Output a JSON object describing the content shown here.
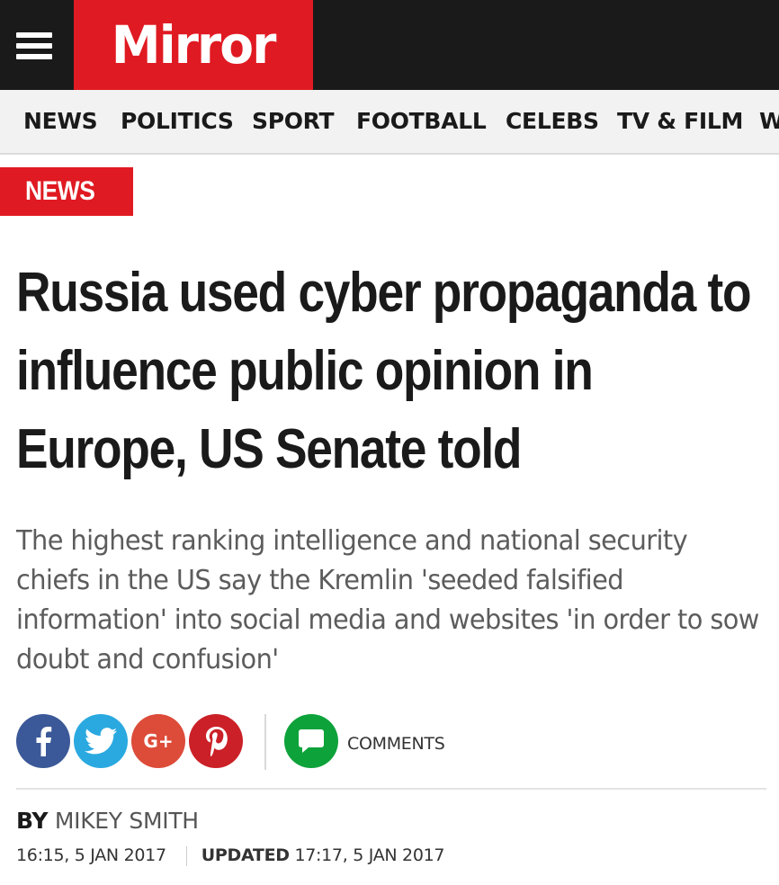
{
  "header": {
    "logo_text": "Mirror",
    "brand_color": "#e01a22",
    "menu_icon": "hamburger-menu-icon"
  },
  "nav": {
    "items": [
      "NEWS",
      "POLITICS",
      "SPORT",
      "FOOTBALL",
      "CELEBS",
      "TV & FILM",
      "W"
    ]
  },
  "article": {
    "section": "NEWS",
    "headline": "Russia used cyber propaganda to influence public opinion in Europe, US Senate told",
    "standfirst": "The highest ranking intelligence and national security chiefs in the US say the Kremlin 'seeded falsified information' into social media and websites 'in order to sow doubt and confusion'",
    "share": {
      "facebook_icon": "facebook-icon",
      "twitter_icon": "twitter-icon",
      "googleplus_label": "G+",
      "pinterest_icon": "pinterest-icon",
      "comments_icon": "comment-bubble-icon",
      "comments_label": "COMMENTS"
    },
    "byline": {
      "by_label": "BY",
      "author": "MIKEY SMITH",
      "published": "16:15, 5 JAN 2017",
      "updated_label": "UPDATED",
      "updated": "17:17, 5 JAN 2017"
    }
  }
}
